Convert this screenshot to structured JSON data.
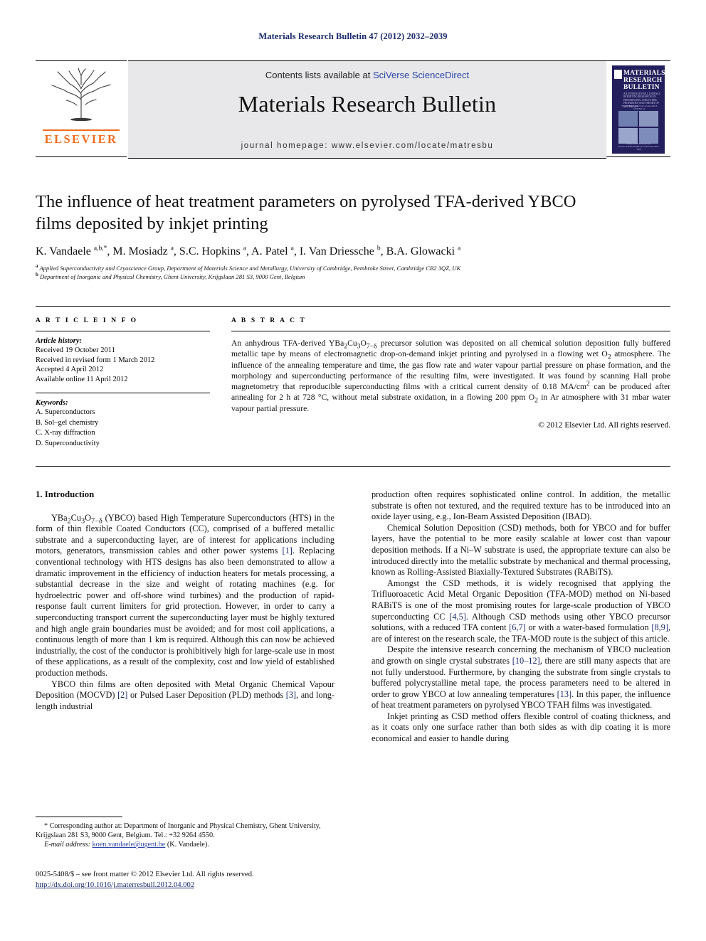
{
  "running_head": "Materials Research Bulletin 47 (2012) 2032–2039",
  "masthead": {
    "contents_prefix": "Contents lists available at ",
    "contents_link": "SciVerse ScienceDirect",
    "journal_name": "Materials Research Bulletin",
    "homepage": "journal homepage: www.elsevier.com/locate/matresbu",
    "publisher_name": "ELSEVIER",
    "cover": {
      "title_line1": "MATERIALS",
      "title_line2": "RESEARCH",
      "title_line3": "BULLETIN",
      "subtitle": "AN INTERNATIONAL JOURNAL REPORTING RESEARCH ON PREPARATION, STRUCTURE, PROPERTIES AND THEORY OF MATERIALS",
      "strip_text": "ELSEVIER JOURNALS AVAILABLE ONLINE AT WWW.SCIENCEDIRECT.COM",
      "foot_text": "AVAILABLE ONLINE AT WWW.SCIENCEDIRECT.COM   ISSN 0025-5408"
    }
  },
  "article": {
    "title": "The influence of heat treatment parameters on pyrolysed TFA-derived YBCO films deposited by inkjet printing",
    "authors_html": "K. Vandaele <sup>a,b,*</sup>, M. Mosiadz <sup>a</sup>, S.C. Hopkins <sup>a</sup>, A. Patel <sup>a</sup>, I. Van Driessche <sup>b</sup>, B.A. Glowacki <sup>a</sup>",
    "affiliation_a": "Applied Superconductivity and Cryoscience Group, Department of Materials Science and Metallurgy, University of Cambridge, Pembroke Street, Cambridge CB2 3QZ, UK",
    "affiliation_b": "Department of Inorganic and Physical Chemistry, Ghent University, Krijgslaan 281 S3, 9000 Gent, Belgium"
  },
  "article_info": {
    "heading": "A R T I C L E   I N F O",
    "history_label": "Article history:",
    "history": [
      "Received 19 October 2011",
      "Received in revised form 1 March 2012",
      "Accepted 4 April 2012",
      "Available online 11 April 2012"
    ],
    "keywords_label": "Keywords:",
    "keywords": [
      "A. Superconductors",
      "B. Sol–gel chemistry",
      "C. X-ray diffraction",
      "D. Superconductivity"
    ]
  },
  "abstract": {
    "heading": "A B S T R A C T",
    "body_html": "An anhydrous TFA-derived YBa<sub>2</sub>Cu<sub>3</sub>O<sub>7−δ</sub> precursor solution was deposited on all chemical solution deposition fully buffered metallic tape by means of electromagnetic drop-on-demand inkjet printing and pyrolysed in a flowing wet O<sub>2</sub> atmosphere. The influence of the annealing temperature and time, the gas flow rate and water vapour partial pressure on phase formation, and the morphology and superconducting performance of the resulting film, were investigated. It was found by scanning Hall probe magnetometry that reproducible superconducting films with a critical current density of 0.18 MA/cm<sup>2</sup> can be produced after annealing for 2 h at 728 °C, without metal substrate oxidation, in a flowing 200 ppm O<sub>2</sub> in Ar atmosphere with 31 mbar water vapour partial pressure.",
    "copyright": "© 2012 Elsevier Ltd. All rights reserved."
  },
  "body": {
    "section_heading": "1. Introduction",
    "left_paragraphs_html": [
      "YBa<sub>2</sub>Cu<sub>3</sub>O<sub>7−δ</sub> (YBCO) based High Temperature Superconductors (HTS) in the form of thin flexible Coated Conductors (CC), comprised of a buffered metallic substrate and a superconducting layer, are of interest for applications including motors, generators, transmission cables and other power systems <span class=\"ref\">[1]</span>. Replacing conventional technology with HTS designs has also been demonstrated to allow a dramatic improvement in the efficiency of induction heaters for metals processing, a substantial decrease in the size and weight of rotating machines (e.g. for hydroelectric power and off-shore wind turbines) and the production of rapid-response fault current limiters for grid protection. However, in order to carry a superconducting transport current the superconducting layer must be highly textured and high angle grain boundaries must be avoided; and for most coil applications, a continuous length of more than 1 km is required. Although this can now be achieved industrially, the cost of the conductor is prohibitively high for large-scale use in most of these applications, as a result of the complexity, cost and low yield of established production methods.",
      "YBCO thin films are often deposited with Metal Organic Chemical Vapour Deposition (MOCVD) <span class=\"ref\">[2]</span> or Pulsed Laser Deposition (PLD) methods <span class=\"ref\">[3]</span>, and long-length industrial"
    ],
    "right_paragraphs_html": [
      "production often requires sophisticated online control. In addition, the metallic substrate is often not textured, and the required texture has to be introduced into an oxide layer using, e.g., Ion-Beam Assisted Deposition (IBAD).",
      "Chemical Solution Deposition (CSD) methods, both for YBCO and for buffer layers, have the potential to be more easily scalable at lower cost than vapour deposition methods. If a Ni–W substrate is used, the appropriate texture can also be introduced directly into the metallic substrate by mechanical and thermal processing, known as Rolling-Assisted Biaxially-Textured Substrates (RABiTS).",
      "Amongst the CSD methods, it is widely recognised that applying the Trifluoroacetic Acid Metal Organic Deposition (TFA-MOD) method on Ni-based RABiTS is one of the most promising routes for large-scale production of YBCO superconducting CC <span class=\"ref\">[4,5]</span>. Although CSD methods using other YBCO precursor solutions, with a reduced TFA content <span class=\"ref\">[6,7]</span> or with a water-based formulation <span class=\"ref\">[8,9]</span>, are of interest on the research scale, the TFA-MOD route is the subject of this article.",
      "Despite the intensive research concerning the mechanism of YBCO nucleation and growth on single crystal substrates <span class=\"ref\">[10–12]</span>, there are still many aspects that are not fully understood. Furthermore, by changing the substrate from single crystals to buffered polycrystalline metal tape, the process parameters need to be altered in order to grow YBCO at low annealing temperatures <span class=\"ref\">[13]</span>. In this paper, the influence of heat treatment parameters on pyrolysed YBCO TFAH films was investigated.",
      "Inkjet printing as CSD method offers flexible control of coating thickness, and as it coats only one surface rather than both sides as with dip coating it is more economical and easier to handle during"
    ]
  },
  "footnote": {
    "corresponding_html": "* Corresponding author at: Department of Inorganic and Physical Chemistry, Ghent University, Krijgslaan 281 S3, 9000 Gent, Belgium. Tel.: +32 9264 4550.",
    "email_label": "E-mail address:",
    "email": "koen.vandaele@ugent.be",
    "email_suffix": "(K. Vandaele)."
  },
  "imprint": {
    "issn_line": "0025-5408/$ – see front matter © 2012 Elsevier Ltd. All rights reserved.",
    "doi": "http://dx.doi.org/10.1016/j.materresbull.2012.04.002"
  },
  "colors": {
    "link_blue": "#2b44a8",
    "ref_blue": "#1a2a6c",
    "elsevier_orange": "#f06d1e",
    "cover_navy": "#231f5c",
    "band_grey": "#e8e8ea"
  }
}
